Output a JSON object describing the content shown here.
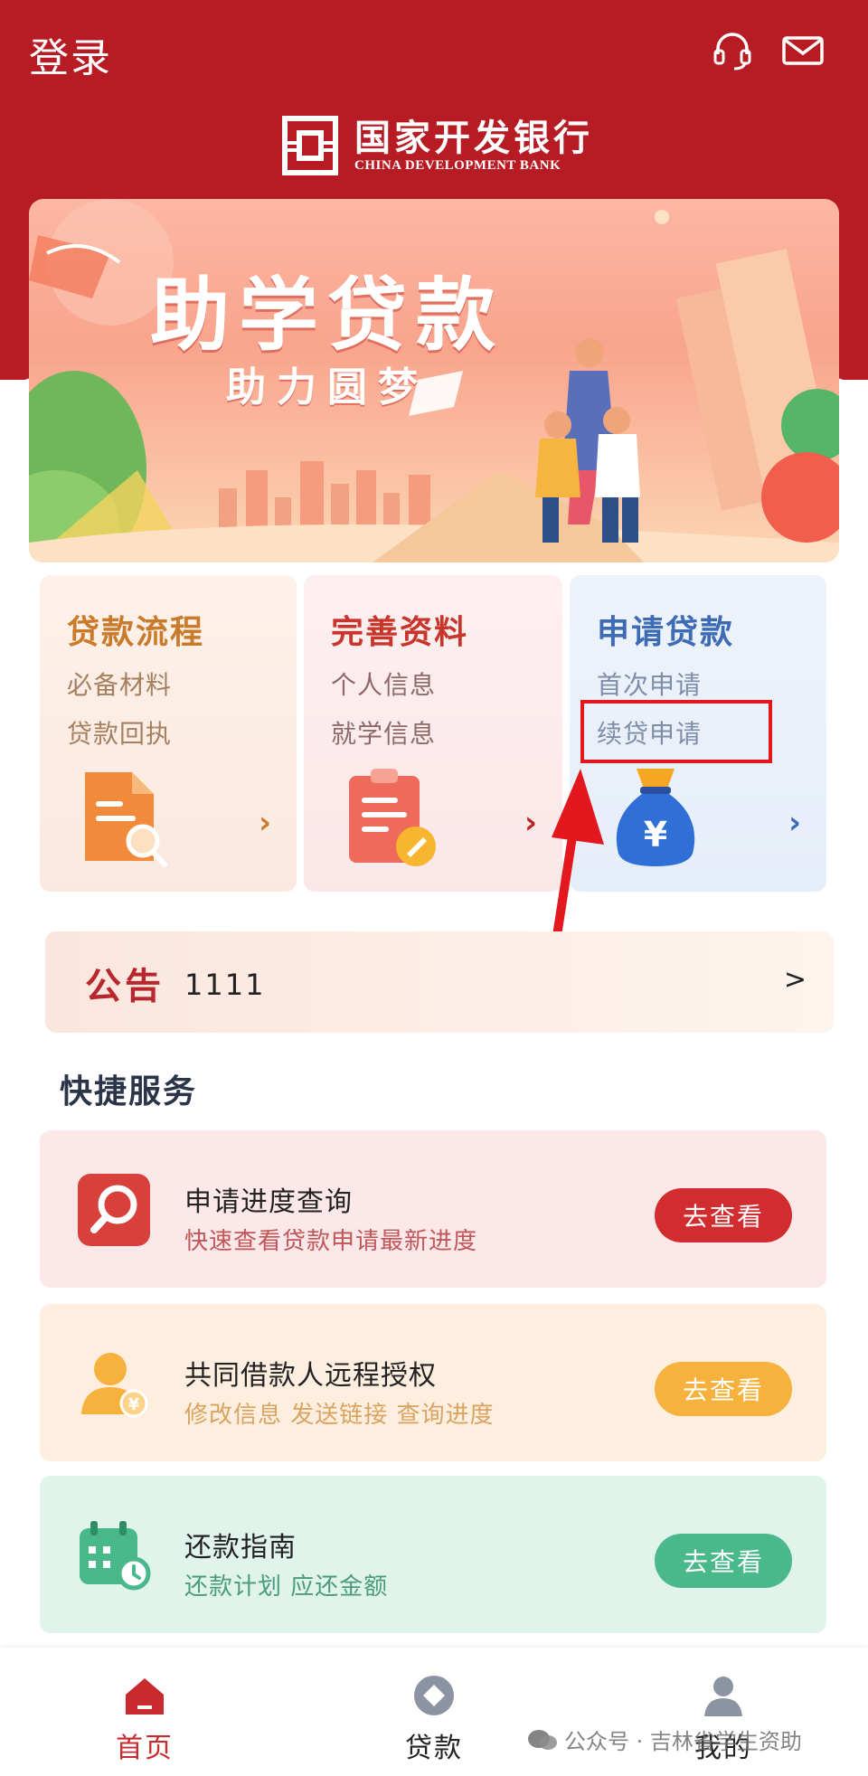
{
  "header": {
    "login_label": "登录",
    "headset_icon": "headset-icon",
    "mail_icon": "mail-icon"
  },
  "brand": {
    "name_cn": "国家开发银行",
    "name_en": "CHINA DEVELOPMENT BANK"
  },
  "banner": {
    "title": "助学贷款",
    "subtitle": "助力圆梦"
  },
  "cards": [
    {
      "title": "贷款流程",
      "items": [
        "必备材料",
        "贷款回执"
      ],
      "icon": "document-search-icon"
    },
    {
      "title": "完善资料",
      "items": [
        "个人信息",
        "就学信息"
      ],
      "icon": "clipboard-edit-icon"
    },
    {
      "title": "申请贷款",
      "items": [
        "首次申请",
        "续贷申请"
      ],
      "icon": "money-bag-icon"
    }
  ],
  "notice": {
    "label": "公告",
    "text": "1111",
    "arrow": ">"
  },
  "quick_services": {
    "title": "快捷服务",
    "items": [
      {
        "title": "申请进度查询",
        "desc": "快速查看贷款申请最新进度",
        "button": "去查看",
        "icon": "search-icon"
      },
      {
        "title": "共同借款人远程授权",
        "desc": "修改信息 发送链接 查询进度",
        "button": "去查看",
        "icon": "user-authorize-icon"
      },
      {
        "title": "还款指南",
        "desc": "还款计划 应还金额",
        "button": "去查看",
        "icon": "calendar-clock-icon"
      }
    ]
  },
  "bottom_nav": {
    "items": [
      {
        "label": "首页",
        "icon": "home-icon",
        "active": true
      },
      {
        "label": "贷款",
        "icon": "loan-icon",
        "active": false
      },
      {
        "label": "我的",
        "icon": "profile-icon",
        "active": false
      }
    ]
  },
  "watermark": {
    "text": "公众号 · 吉林省学生资助"
  },
  "colors": {
    "brand_red": "#b71c25",
    "annotation_red": "#e3171d"
  }
}
